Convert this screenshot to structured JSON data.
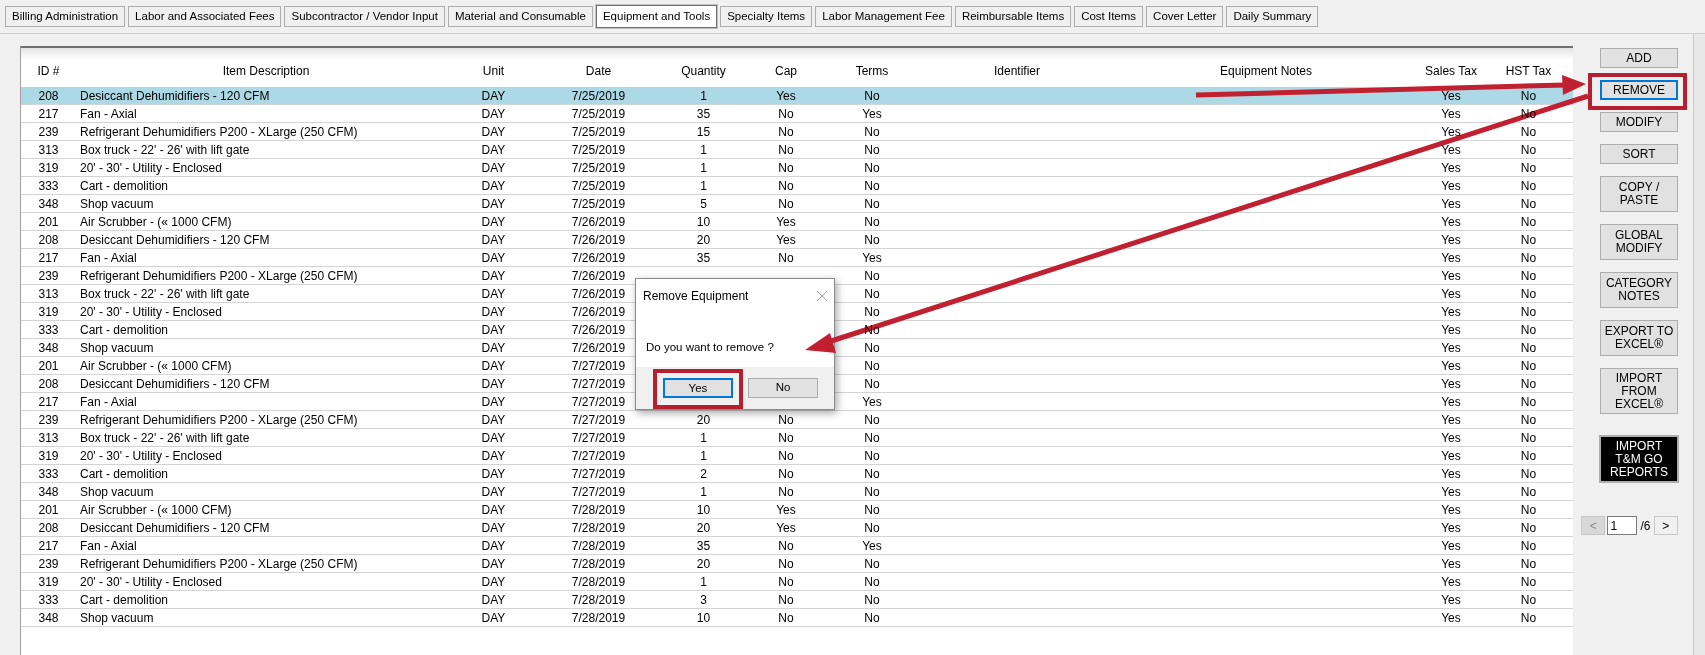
{
  "tabs": [
    {
      "label": "Billing Administration",
      "selected": false
    },
    {
      "label": "Labor and Associated Fees",
      "selected": false
    },
    {
      "label": "Subcontractor / Vendor Input",
      "selected": false
    },
    {
      "label": "Material and Consumable",
      "selected": false
    },
    {
      "label": "Equipment and Tools",
      "selected": true
    },
    {
      "label": "Specialty Items",
      "selected": false
    },
    {
      "label": "Labor Management Fee",
      "selected": false
    },
    {
      "label": "Reimbursable Items",
      "selected": false
    },
    {
      "label": "Cost Items",
      "selected": false
    },
    {
      "label": "Cover Letter",
      "selected": false
    },
    {
      "label": "Daily Summary",
      "selected": false
    }
  ],
  "table": {
    "columns": [
      "ID #",
      "Item Description",
      "Unit",
      "Date",
      "Quantity",
      "Cap",
      "Terms",
      "Identifier",
      "Equipment Notes",
      "Sales Tax",
      "HST Tax"
    ],
    "rows": [
      {
        "selected": true,
        "id": "208",
        "description": "Desiccant Dehumidifiers - 120 CFM",
        "unit": "DAY",
        "date": "7/25/2019",
        "quantity": "1",
        "cap": "Yes",
        "terms": "No",
        "sales_tax": "Yes",
        "hst_tax": "No"
      },
      {
        "selected": false,
        "id": "217",
        "description": "Fan - Axial",
        "unit": "DAY",
        "date": "7/25/2019",
        "quantity": "35",
        "cap": "No",
        "terms": "Yes",
        "sales_tax": "Yes",
        "hst_tax": "No"
      },
      {
        "selected": false,
        "id": "239",
        "description": "Refrigerant Dehumidifiers P200 - XLarge (250 CFM)",
        "unit": "DAY",
        "date": "7/25/2019",
        "quantity": "15",
        "cap": "No",
        "terms": "No",
        "sales_tax": "Yes",
        "hst_tax": "No"
      },
      {
        "selected": false,
        "id": "313",
        "description": "Box truck - 22' - 26' with lift gate",
        "unit": "DAY",
        "date": "7/25/2019",
        "quantity": "1",
        "cap": "No",
        "terms": "No",
        "sales_tax": "Yes",
        "hst_tax": "No"
      },
      {
        "selected": false,
        "id": "319",
        "description": "20' - 30' - Utility - Enclosed",
        "unit": "DAY",
        "date": "7/25/2019",
        "quantity": "1",
        "cap": "No",
        "terms": "No",
        "sales_tax": "Yes",
        "hst_tax": "No"
      },
      {
        "selected": false,
        "id": "333",
        "description": "Cart - demolition",
        "unit": "DAY",
        "date": "7/25/2019",
        "quantity": "1",
        "cap": "No",
        "terms": "No",
        "sales_tax": "Yes",
        "hst_tax": "No"
      },
      {
        "selected": false,
        "id": "348",
        "description": "Shop vacuum",
        "unit": "DAY",
        "date": "7/25/2019",
        "quantity": "5",
        "cap": "No",
        "terms": "No",
        "sales_tax": "Yes",
        "hst_tax": "No"
      },
      {
        "selected": false,
        "id": "201",
        "description": "Air Scrubber - (« 1000 CFM)",
        "unit": "DAY",
        "date": "7/26/2019",
        "quantity": "10",
        "cap": "Yes",
        "terms": "No",
        "sales_tax": "Yes",
        "hst_tax": "No"
      },
      {
        "selected": false,
        "id": "208",
        "description": "Desiccant Dehumidifiers - 120 CFM",
        "unit": "DAY",
        "date": "7/26/2019",
        "quantity": "20",
        "cap": "Yes",
        "terms": "No",
        "sales_tax": "Yes",
        "hst_tax": "No"
      },
      {
        "selected": false,
        "id": "217",
        "description": "Fan - Axial",
        "unit": "DAY",
        "date": "7/26/2019",
        "quantity": "35",
        "cap": "No",
        "terms": "Yes",
        "sales_tax": "Yes",
        "hst_tax": "No"
      },
      {
        "selected": false,
        "id": "239",
        "description": "Refrigerant Dehumidifiers P200 - XLarge (250 CFM)",
        "unit": "DAY",
        "date": "7/26/2019",
        "terms": "No",
        "sales_tax": "Yes",
        "hst_tax": "No"
      },
      {
        "selected": false,
        "id": "313",
        "description": "Box truck - 22' - 26' with lift gate",
        "unit": "DAY",
        "date": "7/26/2019",
        "terms": "No",
        "sales_tax": "Yes",
        "hst_tax": "No"
      },
      {
        "selected": false,
        "id": "319",
        "description": "20' - 30' - Utility - Enclosed",
        "unit": "DAY",
        "date": "7/26/2019",
        "terms": "No",
        "sales_tax": "Yes",
        "hst_tax": "No"
      },
      {
        "selected": false,
        "id": "333",
        "description": "Cart - demolition",
        "unit": "DAY",
        "date": "7/26/2019",
        "terms": "No",
        "sales_tax": "Yes",
        "hst_tax": "No"
      },
      {
        "selected": false,
        "id": "348",
        "description": "Shop vacuum",
        "unit": "DAY",
        "date": "7/26/2019",
        "terms": "No",
        "sales_tax": "Yes",
        "hst_tax": "No"
      },
      {
        "selected": false,
        "id": "201",
        "description": "Air Scrubber - (« 1000 CFM)",
        "unit": "DAY",
        "date": "7/27/2019",
        "terms": "No",
        "sales_tax": "Yes",
        "hst_tax": "No"
      },
      {
        "selected": false,
        "id": "208",
        "description": "Desiccant Dehumidifiers - 120 CFM",
        "unit": "DAY",
        "date": "7/27/2019",
        "terms": "No",
        "sales_tax": "Yes",
        "hst_tax": "No"
      },
      {
        "selected": false,
        "id": "217",
        "description": "Fan - Axial",
        "unit": "DAY",
        "date": "7/27/2019",
        "terms": "Yes",
        "sales_tax": "Yes",
        "hst_tax": "No"
      },
      {
        "selected": false,
        "id": "239",
        "description": "Refrigerant Dehumidifiers P200 - XLarge (250 CFM)",
        "unit": "DAY",
        "date": "7/27/2019",
        "quantity": "20",
        "cap": "No",
        "terms": "No",
        "sales_tax": "Yes",
        "hst_tax": "No"
      },
      {
        "selected": false,
        "id": "313",
        "description": "Box truck - 22' - 26' with lift gate",
        "unit": "DAY",
        "date": "7/27/2019",
        "quantity": "1",
        "cap": "No",
        "terms": "No",
        "sales_tax": "Yes",
        "hst_tax": "No"
      },
      {
        "selected": false,
        "id": "319",
        "description": "20' - 30' - Utility - Enclosed",
        "unit": "DAY",
        "date": "7/27/2019",
        "quantity": "1",
        "cap": "No",
        "terms": "No",
        "sales_tax": "Yes",
        "hst_tax": "No"
      },
      {
        "selected": false,
        "id": "333",
        "description": "Cart - demolition",
        "unit": "DAY",
        "date": "7/27/2019",
        "quantity": "2",
        "cap": "No",
        "terms": "No",
        "sales_tax": "Yes",
        "hst_tax": "No"
      },
      {
        "selected": false,
        "id": "348",
        "description": "Shop vacuum",
        "unit": "DAY",
        "date": "7/27/2019",
        "quantity": "1",
        "cap": "No",
        "terms": "No",
        "sales_tax": "Yes",
        "hst_tax": "No"
      },
      {
        "selected": false,
        "id": "201",
        "description": "Air Scrubber - (« 1000 CFM)",
        "unit": "DAY",
        "date": "7/28/2019",
        "quantity": "10",
        "cap": "Yes",
        "terms": "No",
        "sales_tax": "Yes",
        "hst_tax": "No"
      },
      {
        "selected": false,
        "id": "208",
        "description": "Desiccant Dehumidifiers - 120 CFM",
        "unit": "DAY",
        "date": "7/28/2019",
        "quantity": "20",
        "cap": "Yes",
        "terms": "No",
        "sales_tax": "Yes",
        "hst_tax": "No"
      },
      {
        "selected": false,
        "id": "217",
        "description": "Fan - Axial",
        "unit": "DAY",
        "date": "7/28/2019",
        "quantity": "35",
        "cap": "No",
        "terms": "Yes",
        "sales_tax": "Yes",
        "hst_tax": "No"
      },
      {
        "selected": false,
        "id": "239",
        "description": "Refrigerant Dehumidifiers P200 - XLarge (250 CFM)",
        "unit": "DAY",
        "date": "7/28/2019",
        "quantity": "20",
        "cap": "No",
        "terms": "No",
        "sales_tax": "Yes",
        "hst_tax": "No"
      },
      {
        "selected": false,
        "id": "319",
        "description": "20' - 30' - Utility - Enclosed",
        "unit": "DAY",
        "date": "7/28/2019",
        "quantity": "1",
        "cap": "No",
        "terms": "No",
        "sales_tax": "Yes",
        "hst_tax": "No"
      },
      {
        "selected": false,
        "id": "333",
        "description": "Cart - demolition",
        "unit": "DAY",
        "date": "7/28/2019",
        "quantity": "3",
        "cap": "No",
        "terms": "No",
        "sales_tax": "Yes",
        "hst_tax": "No"
      },
      {
        "selected": false,
        "id": "348",
        "description": "Shop vacuum",
        "unit": "DAY",
        "date": "7/28/2019",
        "quantity": "10",
        "cap": "No",
        "terms": "No",
        "sales_tax": "Yes",
        "hst_tax": "No"
      }
    ]
  },
  "side_buttons": [
    {
      "kind": "normal",
      "lines": [
        "ADD"
      ],
      "focused": false
    },
    {
      "kind": "normal",
      "lines": [
        "REMOVE"
      ],
      "focused": true
    },
    {
      "kind": "normal",
      "lines": [
        "MODIFY"
      ],
      "focused": false
    },
    {
      "kind": "normal",
      "lines": [
        "SORT"
      ],
      "focused": false
    },
    {
      "kind": "normal",
      "lines": [
        "COPY /",
        "PASTE"
      ],
      "focused": false
    },
    {
      "kind": "normal",
      "lines": [
        "GLOBAL",
        "MODIFY"
      ],
      "focused": false
    },
    {
      "kind": "normal",
      "lines": [
        "CATEGORY",
        "NOTES"
      ],
      "focused": false
    },
    {
      "kind": "normal",
      "lines": [
        "EXPORT TO",
        "EXCEL®"
      ],
      "focused": false
    },
    {
      "kind": "normal",
      "lines": [
        "IMPORT",
        "FROM",
        "EXCEL®"
      ],
      "focused": false
    },
    {
      "kind": "dark",
      "lines": [
        "IMPORT",
        "T&M GO",
        "REPORTS"
      ],
      "focused": false
    }
  ],
  "pager": {
    "prev": {
      "label": "<",
      "disabled": true
    },
    "page": "1",
    "total": "/6",
    "next": {
      "label": ">",
      "disabled": false
    }
  },
  "dialog": {
    "title": "Remove Equipment",
    "message": "Do you want to remove ?",
    "buttons": [
      {
        "label": "Yes",
        "focused": true
      },
      {
        "label": "No",
        "focused": false
      }
    ]
  }
}
